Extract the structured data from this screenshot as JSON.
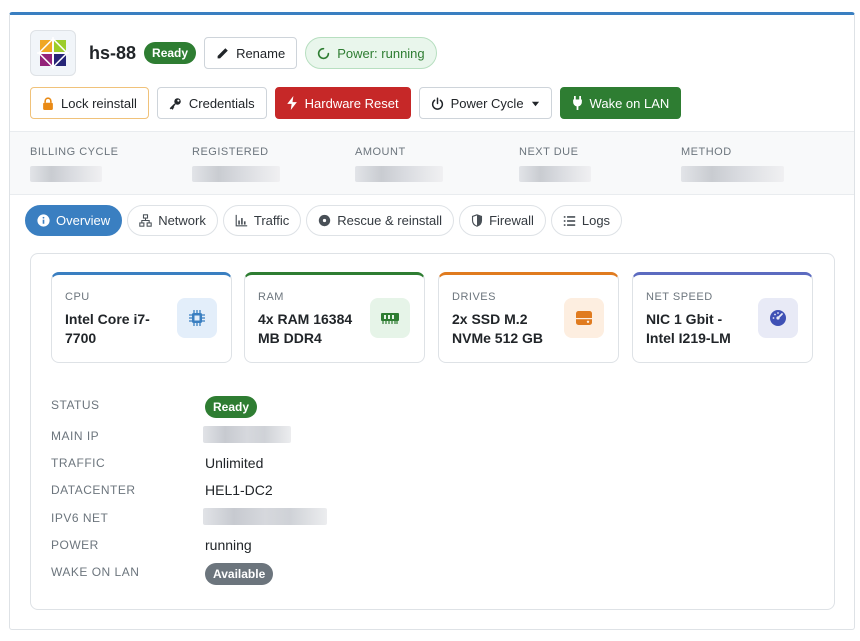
{
  "server": {
    "hostname": "hs-88",
    "status": "Ready",
    "rename_label": "Rename",
    "power_label": "Power: running"
  },
  "actions": {
    "lock_reinstall": "Lock reinstall",
    "credentials": "Credentials",
    "hardware_reset": "Hardware Reset",
    "power_cycle": "Power Cycle",
    "wake_on_lan": "Wake on LAN"
  },
  "billing": {
    "billing_cycle": "BILLING CYCLE",
    "registered": "REGISTERED",
    "amount": "AMOUNT",
    "next_due": "NEXT DUE",
    "method": "METHOD"
  },
  "tabs": [
    {
      "label": "Overview",
      "icon": "info-icon"
    },
    {
      "label": "Network",
      "icon": "network-icon"
    },
    {
      "label": "Traffic",
      "icon": "chart-icon"
    },
    {
      "label": "Rescue & reinstall",
      "icon": "disc-icon"
    },
    {
      "label": "Firewall",
      "icon": "shield-icon"
    },
    {
      "label": "Logs",
      "icon": "list-icon"
    }
  ],
  "specs": [
    {
      "label": "CPU",
      "value": "Intel Core i7-7700",
      "icon": "chip-icon"
    },
    {
      "label": "RAM",
      "value": "4x RAM 16384 MB DDR4",
      "icon": "memory-icon"
    },
    {
      "label": "DRIVES",
      "value": "2x SSD M.2 NVMe 512 GB",
      "icon": "hdd-icon"
    },
    {
      "label": "NET SPEED",
      "value": "NIC 1 Gbit - Intel I219-LM",
      "icon": "gauge-icon"
    }
  ],
  "details": {
    "status_label": "STATUS",
    "status_value": "Ready",
    "main_ip_label": "MAIN IP",
    "traffic_label": "TRAFFIC",
    "traffic_value": "Unlimited",
    "datacenter_label": "DATACENTER",
    "datacenter_value": "HEL1-DC2",
    "ipv6_label": "IPV6 NET",
    "power_label": "POWER",
    "power_value": "running",
    "wol_label": "WAKE ON LAN",
    "wol_value": "Available"
  },
  "colors": {
    "accent": "#3a7fc1",
    "success": "#2e7d32",
    "danger": "#c62828",
    "warning": "#e07b1f",
    "indigo": "#5c6bc0"
  }
}
